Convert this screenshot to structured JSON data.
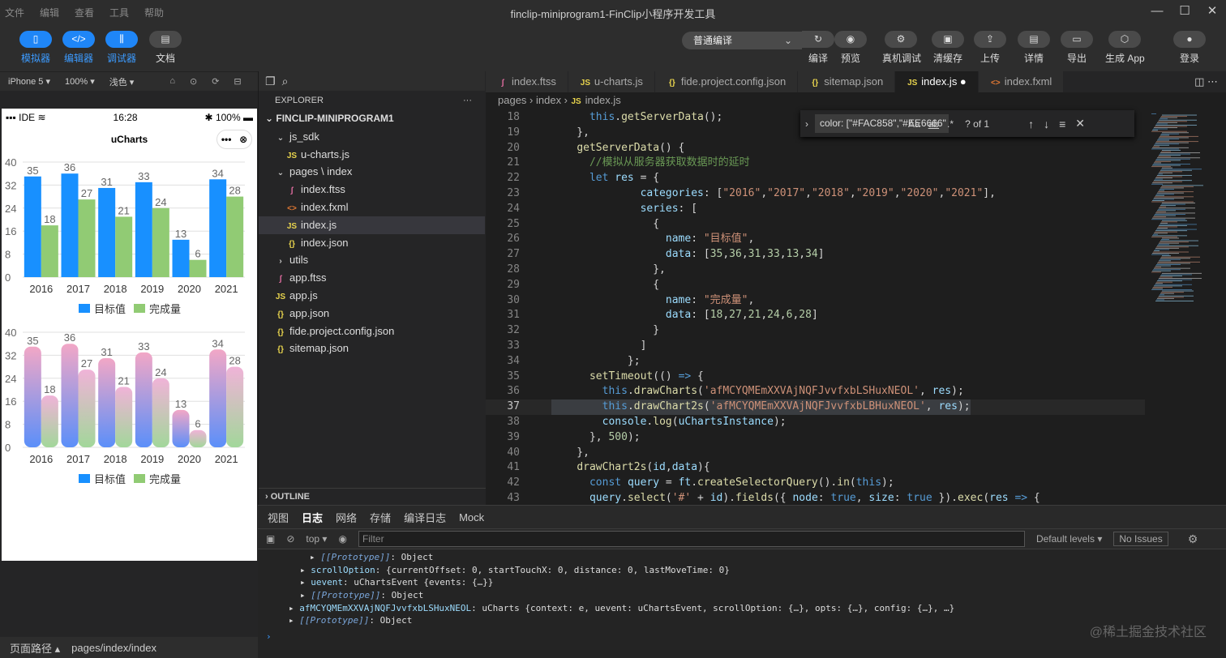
{
  "window": {
    "title": "finclip-miniprogram1-FinClip小程序开发工具",
    "menus": [
      "文件",
      "编辑",
      "查看",
      "工具",
      "帮助"
    ],
    "controls": [
      "—",
      "☐",
      "✕"
    ]
  },
  "toolbar": {
    "left": [
      {
        "label": "模拟器",
        "icon": "phone-icon",
        "glyph": "▯"
      },
      {
        "label": "编辑器",
        "icon": "code-icon",
        "glyph": "</>"
      },
      {
        "label": "调试器",
        "icon": "debug-icon",
        "glyph": "⫼"
      },
      {
        "label": "文档",
        "icon": "doc-icon",
        "glyph": "▤"
      }
    ],
    "compile_mode": "普通编译",
    "right": [
      {
        "label": "编译",
        "glyph": "↻"
      },
      {
        "label": "预览",
        "glyph": "◉"
      },
      {
        "label": "真机调试",
        "glyph": "⚙"
      },
      {
        "label": "清缓存",
        "glyph": "▣"
      },
      {
        "label": "上传",
        "glyph": "⇪"
      },
      {
        "label": "详情",
        "glyph": "▤"
      },
      {
        "label": "导出",
        "glyph": "▭"
      },
      {
        "label": "生成 App",
        "glyph": "⬡"
      },
      {
        "label": "登录",
        "glyph": "●"
      }
    ]
  },
  "simulator": {
    "device": "iPhone 5",
    "zoom": "100%",
    "theme": "浅色",
    "status": {
      "carrier": "IDE",
      "time": "16:28",
      "battery": "100%"
    },
    "nav_title": "uCharts",
    "capsule_dots": "•••",
    "capsule_close": "⊗"
  },
  "chart_data": [
    {
      "type": "bar",
      "categories": [
        "2016",
        "2017",
        "2018",
        "2019",
        "2020",
        "2021"
      ],
      "ylim": [
        0,
        40
      ],
      "yticks": [
        "0",
        "8",
        "16",
        "24",
        "32",
        "40"
      ],
      "series": [
        {
          "name": "目标值",
          "values": [
            35,
            36,
            31,
            33,
            13,
            34
          ],
          "color": "#1890FF"
        },
        {
          "name": "完成量",
          "values": [
            18,
            27,
            21,
            24,
            6,
            28
          ],
          "color": "#91CB74"
        }
      ]
    },
    {
      "type": "bar",
      "categories": [
        "2016",
        "2017",
        "2018",
        "2019",
        "2020",
        "2021"
      ],
      "ylim": [
        0,
        40
      ],
      "yticks": [
        "0",
        "8",
        "16",
        "24",
        "32",
        "40"
      ],
      "series": [
        {
          "name": "目标值",
          "values": [
            35,
            36,
            31,
            33,
            13,
            34
          ],
          "color": "#1890FF"
        },
        {
          "name": "完成量",
          "values": [
            18,
            27,
            21,
            24,
            6,
            28
          ],
          "color": "#91CB74"
        }
      ]
    }
  ],
  "footer": {
    "label": "页面路径",
    "path": "pages/index/index"
  },
  "explorer": {
    "title": "EXPLORER",
    "more": "···",
    "root": "FINCLIP-MINIPROGRAM1",
    "items": [
      {
        "label": "js_sdk",
        "kind": "folder",
        "open": true,
        "depth": 1
      },
      {
        "label": "u-charts.js",
        "kind": "js",
        "depth": 2
      },
      {
        "label": "pages \\ index",
        "kind": "folder",
        "open": true,
        "depth": 1
      },
      {
        "label": "index.ftss",
        "kind": "ftss",
        "depth": 2
      },
      {
        "label": "index.fxml",
        "kind": "fxml",
        "depth": 2
      },
      {
        "label": "index.js",
        "kind": "js",
        "depth": 2,
        "selected": true
      },
      {
        "label": "index.json",
        "kind": "json",
        "depth": 2
      },
      {
        "label": "utils",
        "kind": "folder",
        "open": false,
        "depth": 1
      },
      {
        "label": "app.ftss",
        "kind": "ftss",
        "depth": 1
      },
      {
        "label": "app.js",
        "kind": "js",
        "depth": 1
      },
      {
        "label": "app.json",
        "kind": "json",
        "depth": 1
      },
      {
        "label": "fide.project.config.json",
        "kind": "json",
        "depth": 1
      },
      {
        "label": "sitemap.json",
        "kind": "json",
        "depth": 1
      }
    ],
    "outline": "OUTLINE"
  },
  "editor": {
    "tabs": [
      {
        "label": "index.ftss",
        "kind": "ftss"
      },
      {
        "label": "u-charts.js",
        "kind": "js"
      },
      {
        "label": "fide.project.config.json",
        "kind": "json"
      },
      {
        "label": "sitemap.json",
        "kind": "json"
      },
      {
        "label": "index.js",
        "kind": "js",
        "active": true,
        "dirty": "●"
      },
      {
        "label": "index.fxml",
        "kind": "fxml"
      }
    ],
    "breadcrumb": [
      "pages",
      "index",
      "index.js"
    ],
    "find": {
      "query": "color: [\"#FAC858\",\"#EE6666\"",
      "result": "? of 1",
      "aa": "Aa",
      "ab": "ab",
      "re": ".*"
    },
    "current_line": 37
  },
  "panel": {
    "tabs": [
      "视图",
      "日志",
      "网络",
      "存储",
      "编译日志",
      "Mock"
    ],
    "active": "日志",
    "context": "top",
    "filter_placeholder": "Filter",
    "levels": "Default levels",
    "issues": "No Issues",
    "prompt": "›"
  },
  "watermark": "@稀土掘金技术社区"
}
